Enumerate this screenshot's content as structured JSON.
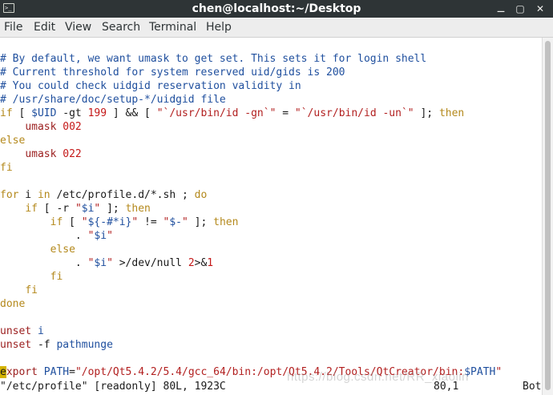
{
  "window": {
    "title": "chen@localhost:~/Desktop",
    "terminal_icon_glyph": ">_",
    "minimize_glyph": "⚊",
    "maximize_glyph": "▢",
    "close_glyph": "✕"
  },
  "menu": [
    "File",
    "Edit",
    "View",
    "Search",
    "Terminal",
    "Help"
  ],
  "colors": {
    "comment": "#1f4f9e",
    "keyword": "#b4891c",
    "string": "#b22020",
    "number": "#c41818",
    "cursor": "#d4b300",
    "titlebar": "#2e3436"
  },
  "code_lines": [
    "# By default, we want umask to get set. This sets it for login shell",
    "# Current threshold for system reserved uid/gids is 200",
    "# You could check uidgid reservation validity in",
    "# /usr/share/doc/setup-*/uidgid file",
    "if [ $UID -gt 199 ] && [ \"`/usr/bin/id -gn`\" = \"`/usr/bin/id -un`\" ]; then",
    "    umask 002",
    "else",
    "    umask 022",
    "fi",
    "",
    "for i in /etc/profile.d/*.sh ; do",
    "    if [ -r \"$i\" ]; then",
    "        if [ \"${-#*i}\" != \"$-\" ]; then",
    "            . \"$i\"",
    "        else",
    "            . \"$i\" >/dev/null 2>&1",
    "        fi",
    "    fi",
    "done",
    "",
    "unset i",
    "unset -f pathmunge",
    "",
    "export PATH=\"/opt/Qt5.4.2/5.4/gcc_64/bin:/opt/Qt5.4.2/Tools/QtCreator/bin:$PATH\""
  ],
  "status": {
    "file_info": "\"/etc/profile\" [readonly] 80L, 1923C",
    "position": "80,1",
    "percent": "Bot"
  },
  "watermark": "https://blog.csdn.net/RR_xiaolin"
}
